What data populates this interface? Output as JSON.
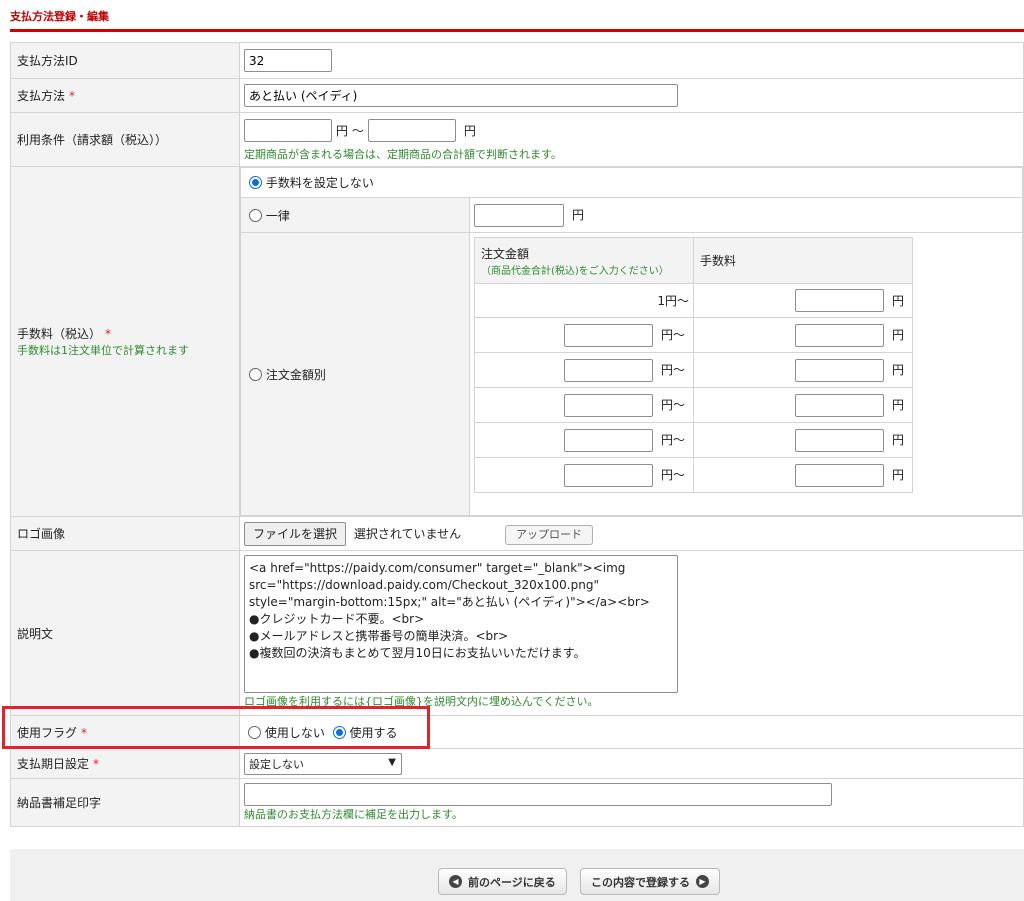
{
  "page": {
    "title": "支払方法登録・編集"
  },
  "form": {
    "payment_id": {
      "label": "支払方法ID",
      "value": "32"
    },
    "payment_method": {
      "label": "支払方法",
      "required_mark": "*",
      "value": "あと払い (ペイディ)"
    },
    "usage_condition": {
      "label": "利用条件（請求額（税込））",
      "min_value": "",
      "range_sep": "円 〜",
      "max_unit": "円",
      "note": "定期商品が含まれる場合は、定期商品の合計額で判断されます。"
    },
    "fee": {
      "label": "手数料（税込）",
      "required_mark": "*",
      "note": "手数料は1注文単位で計算されます",
      "option_none": "手数料を設定しない",
      "option_flat": "一律",
      "option_by_amount": "注文金額別",
      "selected": "none",
      "flat_unit": "円",
      "tier_header_amount": "注文金額",
      "tier_header_amount_note": "（商品代金合計(税込)をご入力ください）",
      "tier_header_fee": "手数料",
      "first_tier_amount": "1円〜",
      "tier_suffix": "円〜",
      "fee_unit": "円"
    },
    "logo": {
      "label": "ロゴ画像",
      "choose_file": "ファイルを選択",
      "no_file": "選択されていません",
      "upload": "アップロード"
    },
    "description": {
      "label": "説明文",
      "value": "<a href=\"https://paidy.com/consumer\" target=\"_blank\"><img src=\"https://download.paidy.com/Checkout_320x100.png\" style=\"margin-bottom:15px;\" alt=\"あと払い (ペイディ)\"></a><br>\n●クレジットカード不要。<br>\n●メールアドレスと携帯番号の簡単決済。<br>\n●複数回の決済もまとめて翌月10日にお支払いいただけます。",
      "note": "ロゴ画像を利用するには{ロゴ画像}を説明文内に埋め込んでください。"
    },
    "use_flag": {
      "label": "使用フラグ",
      "required_mark": "*",
      "option_off": "使用しない",
      "option_on": "使用する",
      "selected": "on"
    },
    "due_date": {
      "label": "支払期日設定",
      "required_mark": "*",
      "value": "設定しない"
    },
    "delivery_note": {
      "label": "納品書補足印字",
      "value": "",
      "note": "納品書のお支払方法欄に補足を出力します。"
    }
  },
  "footer": {
    "back_label": "前のページに戻る",
    "submit_label": "この内容で登録する"
  },
  "colors": {
    "accent_red": "#d40000",
    "radio_blue": "#0b6fd8",
    "note_green": "#2e8b2e"
  }
}
